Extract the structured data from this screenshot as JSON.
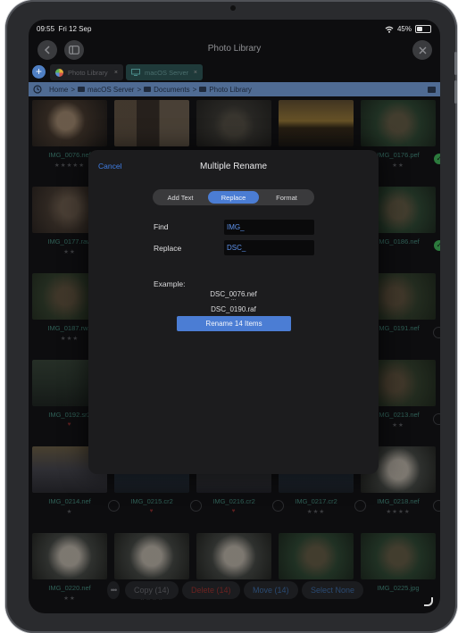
{
  "status_bar": {
    "time": "09:55",
    "date": "Fri 12 Sep",
    "battery": "45%",
    "wifi_icon": "wifi-icon",
    "battery_icon": "battery-icon"
  },
  "nav": {
    "title": "Photo Library",
    "back_icon": "chevron-left-icon",
    "sidebar_icon": "sidebar-icon",
    "close_icon": "close-icon"
  },
  "tabs": [
    {
      "label": "Photo Library",
      "icon": "photos-icon",
      "close": "×",
      "active": false
    },
    {
      "label": "macOS Server",
      "icon": "monitor-icon",
      "close": "×",
      "active": true
    }
  ],
  "add_tab_label": "+",
  "breadcrumb": {
    "history_icon": "history-icon",
    "items": [
      "Home",
      "macOS Server",
      "Documents",
      "Photo Library"
    ],
    "separator": ">",
    "view_icon": "grid-view-icon"
  },
  "grid": [
    {
      "name": "IMG_0076.nef",
      "stars": "★★★★★",
      "state": "none",
      "tone": "owl-dark"
    },
    {
      "name": "",
      "stars": "",
      "state": "none",
      "tone": "owl-wood"
    },
    {
      "name": "",
      "stars": "",
      "state": "none",
      "tone": "owl-ground"
    },
    {
      "name": "",
      "stars": "",
      "state": "none",
      "tone": "sunset"
    },
    {
      "name": "IMG_0176.pef",
      "stars": "★★",
      "state": "checked",
      "tone": "owl-green"
    },
    {
      "name": "IMG_0177.raw",
      "stars": "★★",
      "state": "none",
      "tone": "owl-rock"
    },
    {
      "name": "",
      "stars": "",
      "state": "none",
      "tone": "dark"
    },
    {
      "name": "",
      "stars": "",
      "state": "none",
      "tone": "dark"
    },
    {
      "name": "",
      "stars": "",
      "state": "none",
      "tone": "dark"
    },
    {
      "name": "IMG_0186.nef",
      "stars": "",
      "state": "checked",
      "tone": "owl-green"
    },
    {
      "name": "IMG_0187.rw2",
      "stars": "★★★",
      "state": "none",
      "tone": "owl-forest"
    },
    {
      "name": "",
      "stars": "",
      "state": "none",
      "tone": "dark"
    },
    {
      "name": "",
      "stars": "",
      "state": "none",
      "tone": "dark"
    },
    {
      "name": "",
      "stars": "",
      "state": "none",
      "tone": "dark"
    },
    {
      "name": "IMG_0191.nef",
      "stars": "",
      "state": "circle",
      "tone": "owl-forest"
    },
    {
      "name": "IMG_0192.sr2",
      "stars": "♥",
      "state": "none",
      "tone": "water"
    },
    {
      "name": "",
      "stars": "",
      "state": "none",
      "tone": "dark"
    },
    {
      "name": "",
      "stars": "",
      "state": "none",
      "tone": "dark"
    },
    {
      "name": "",
      "stars": "",
      "state": "none",
      "tone": "dark"
    },
    {
      "name": "IMG_0213.nef",
      "stars": "★★",
      "state": "circle",
      "tone": "owl-forest"
    },
    {
      "name": "IMG_0214.nef",
      "stars": "★",
      "state": "circle",
      "tone": "people"
    },
    {
      "name": "IMG_0215.cr2",
      "stars": "♥",
      "state": "circle",
      "tone": "people-dark"
    },
    {
      "name": "IMG_0216.cr2",
      "stars": "♥",
      "state": "circle",
      "tone": "people-light"
    },
    {
      "name": "IMG_0217.cr2",
      "stars": "★★★",
      "state": "circle",
      "tone": "people-dark"
    },
    {
      "name": "IMG_0218.nef",
      "stars": "★★★★",
      "state": "circle",
      "tone": "owl-white"
    },
    {
      "name": "IMG_0220.nef",
      "stars": "★★",
      "state": "none",
      "tone": "owl-white"
    },
    {
      "name": "",
      "stars": "★★★★",
      "state": "none",
      "tone": "owl-white"
    },
    {
      "name": "",
      "stars": "",
      "state": "none",
      "tone": "owl-white"
    },
    {
      "name": "",
      "stars": "",
      "state": "none",
      "tone": "owl-green"
    },
    {
      "name": "IMG_0225.jpg",
      "stars": "",
      "state": "none",
      "tone": "owl-green"
    }
  ],
  "toolbar": {
    "more_icon": "more-icon",
    "copy": "Copy (14)",
    "delete": "Delete (14)",
    "move": "Move (14)",
    "select_none": "Select None"
  },
  "modal": {
    "cancel": "Cancel",
    "title": "Multiple Rename",
    "segments": [
      "Add Text",
      "Replace",
      "Format"
    ],
    "active_segment": "Replace",
    "find_label": "Find",
    "find_value": "IMG_",
    "replace_label": "Replace",
    "replace_value": "DSC_",
    "example_label": "Example:",
    "example_lines": [
      "DSC_0076.nef",
      "...",
      "DSC_0190.raf"
    ],
    "rename_button": "Rename 14 Items"
  },
  "colors": {
    "accent": "#4b7dd4",
    "breadcrumb_bg": "#4f6b93",
    "check_green": "#2c7a3d",
    "modal_bg": "#1c1c1e"
  }
}
